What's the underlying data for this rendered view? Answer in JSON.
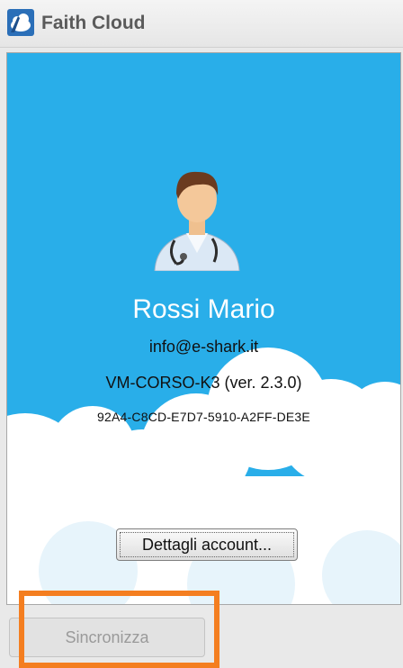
{
  "window": {
    "title": "Faith Cloud",
    "icon": "cloud-app-icon"
  },
  "profile": {
    "avatar_icon": "doctor-avatar-icon",
    "name": "Rossi Mario",
    "email": "info@e-shark.it",
    "machine": "VM-CORSO-K3 (ver. 2.3.0)",
    "license_key": "92A4-C8CD-E7D7-5910-A2FF-DE3E"
  },
  "buttons": {
    "details_label": "Dettagli account...",
    "sync_label": "Sincronizza"
  },
  "colors": {
    "panel_background": "#29aee9",
    "highlight": "#f47e20",
    "clouds": "#ffffff"
  }
}
